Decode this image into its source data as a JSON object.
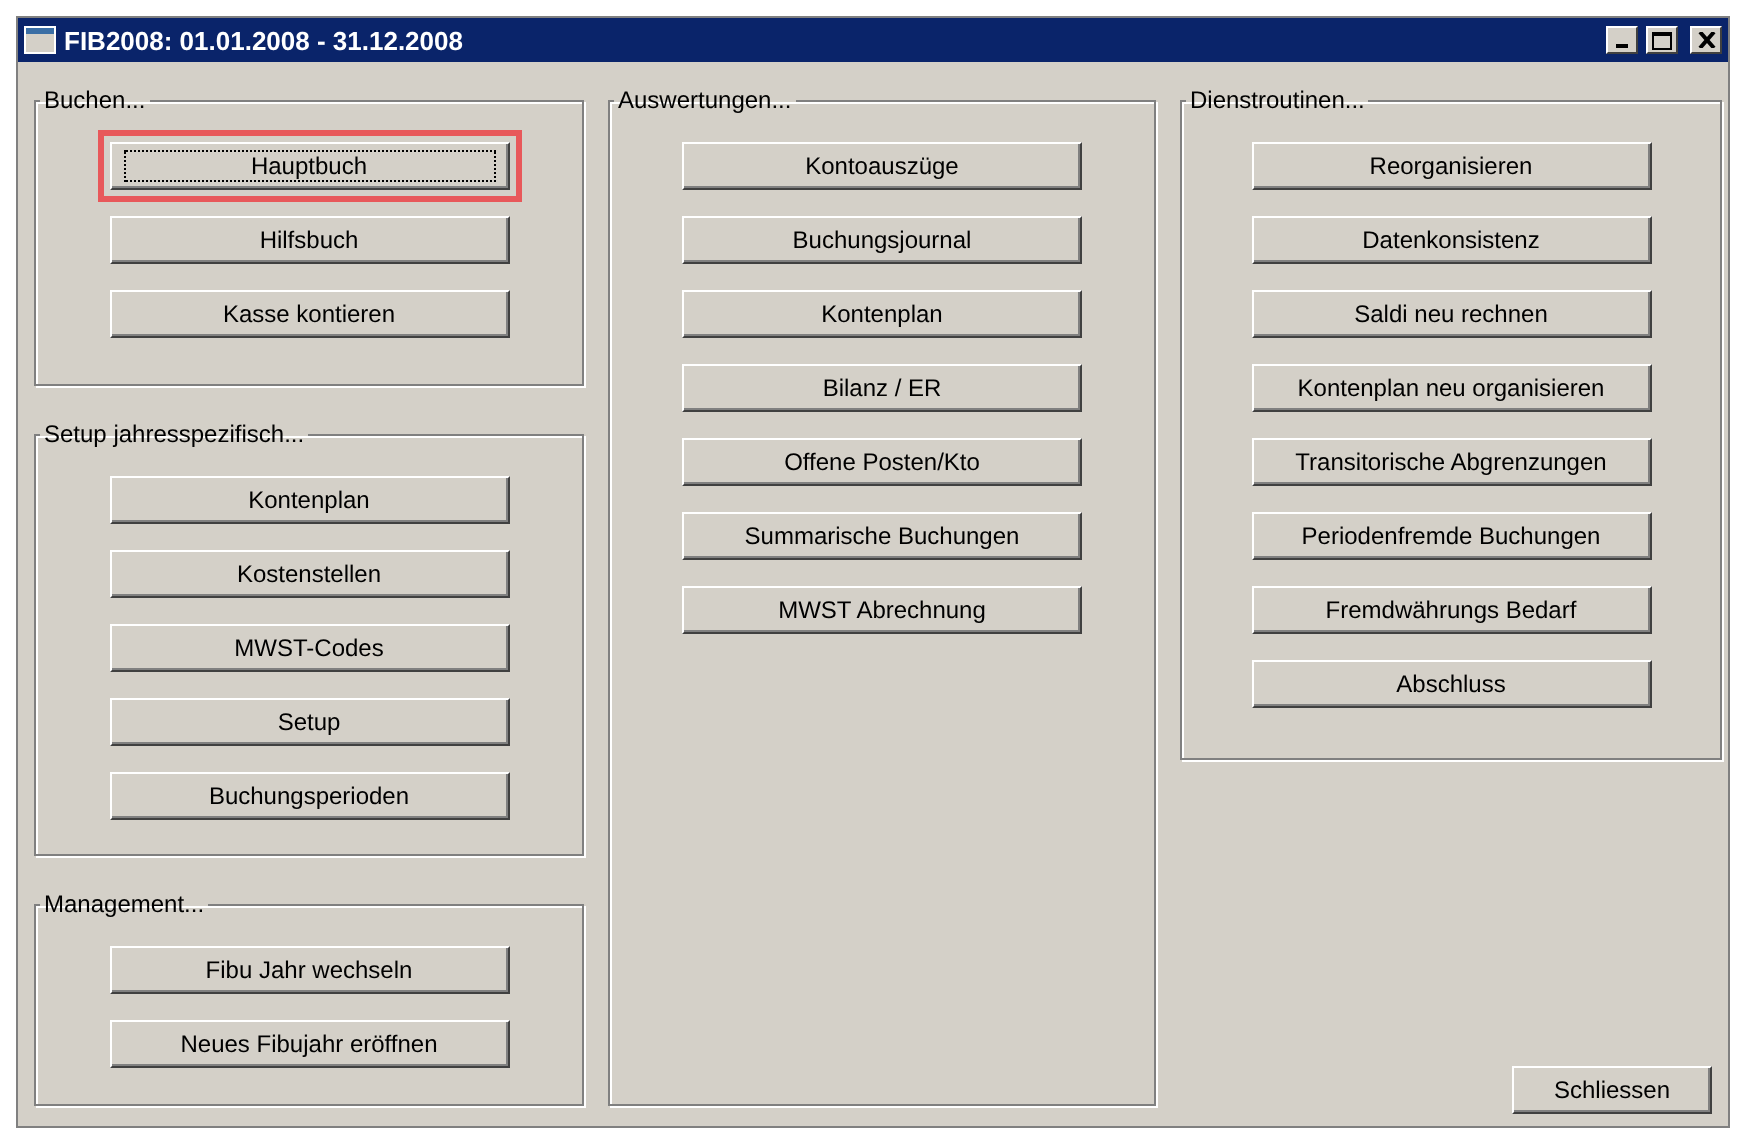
{
  "window": {
    "title": "FIB2008: 01.01.2008 - 31.12.2008"
  },
  "columns": [
    {
      "groups": [
        {
          "title": "Buchen...",
          "buttons": [
            {
              "label": "Hauptbuch",
              "focused": true,
              "highlighted": true
            },
            {
              "label": "Hilfsbuch",
              "focused": false,
              "highlighted": false
            },
            {
              "label": "Kasse kontieren",
              "focused": false,
              "highlighted": false
            }
          ]
        },
        {
          "title": "Setup jahresspezifisch...",
          "buttons": [
            {
              "label": "Kontenplan",
              "focused": false,
              "highlighted": false
            },
            {
              "label": "Kostenstellen",
              "focused": false,
              "highlighted": false
            },
            {
              "label": "MWST-Codes",
              "focused": false,
              "highlighted": false
            },
            {
              "label": "Setup",
              "focused": false,
              "highlighted": false
            },
            {
              "label": "Buchungsperioden",
              "focused": false,
              "highlighted": false
            }
          ]
        },
        {
          "title": "Management...",
          "buttons": [
            {
              "label": "Fibu Jahr wechseln",
              "focused": false,
              "highlighted": false
            },
            {
              "label": "Neues Fibujahr eröffnen",
              "focused": false,
              "highlighted": false
            }
          ]
        }
      ]
    },
    {
      "groups": [
        {
          "title": "Auswertungen...",
          "buttons": [
            {
              "label": "Kontoauszüge",
              "focused": false,
              "highlighted": false
            },
            {
              "label": "Buchungsjournal",
              "focused": false,
              "highlighted": false
            },
            {
              "label": "Kontenplan",
              "focused": false,
              "highlighted": false
            },
            {
              "label": "Bilanz / ER",
              "focused": false,
              "highlighted": false
            },
            {
              "label": "Offene Posten/Kto",
              "focused": false,
              "highlighted": false
            },
            {
              "label": "Summarische Buchungen",
              "focused": false,
              "highlighted": false
            },
            {
              "label": "MWST Abrechnung",
              "focused": false,
              "highlighted": false
            }
          ]
        }
      ]
    },
    {
      "groups": [
        {
          "title": "Dienstroutinen...",
          "buttons": [
            {
              "label": "Reorganisieren",
              "focused": false,
              "highlighted": false
            },
            {
              "label": "Datenkonsistenz",
              "focused": false,
              "highlighted": false
            },
            {
              "label": "Saldi neu rechnen",
              "focused": false,
              "highlighted": false
            },
            {
              "label": "Kontenplan neu organisieren",
              "focused": false,
              "highlighted": false
            },
            {
              "label": "Transitorische Abgrenzungen",
              "focused": false,
              "highlighted": false
            },
            {
              "label": "Periodenfremde Buchungen",
              "focused": false,
              "highlighted": false
            },
            {
              "label": "Fremdwährungs Bedarf",
              "focused": false,
              "highlighted": false
            },
            {
              "label": "Abschluss",
              "focused": false,
              "highlighted": false
            }
          ]
        }
      ]
    }
  ],
  "close_button": "Schliessen"
}
